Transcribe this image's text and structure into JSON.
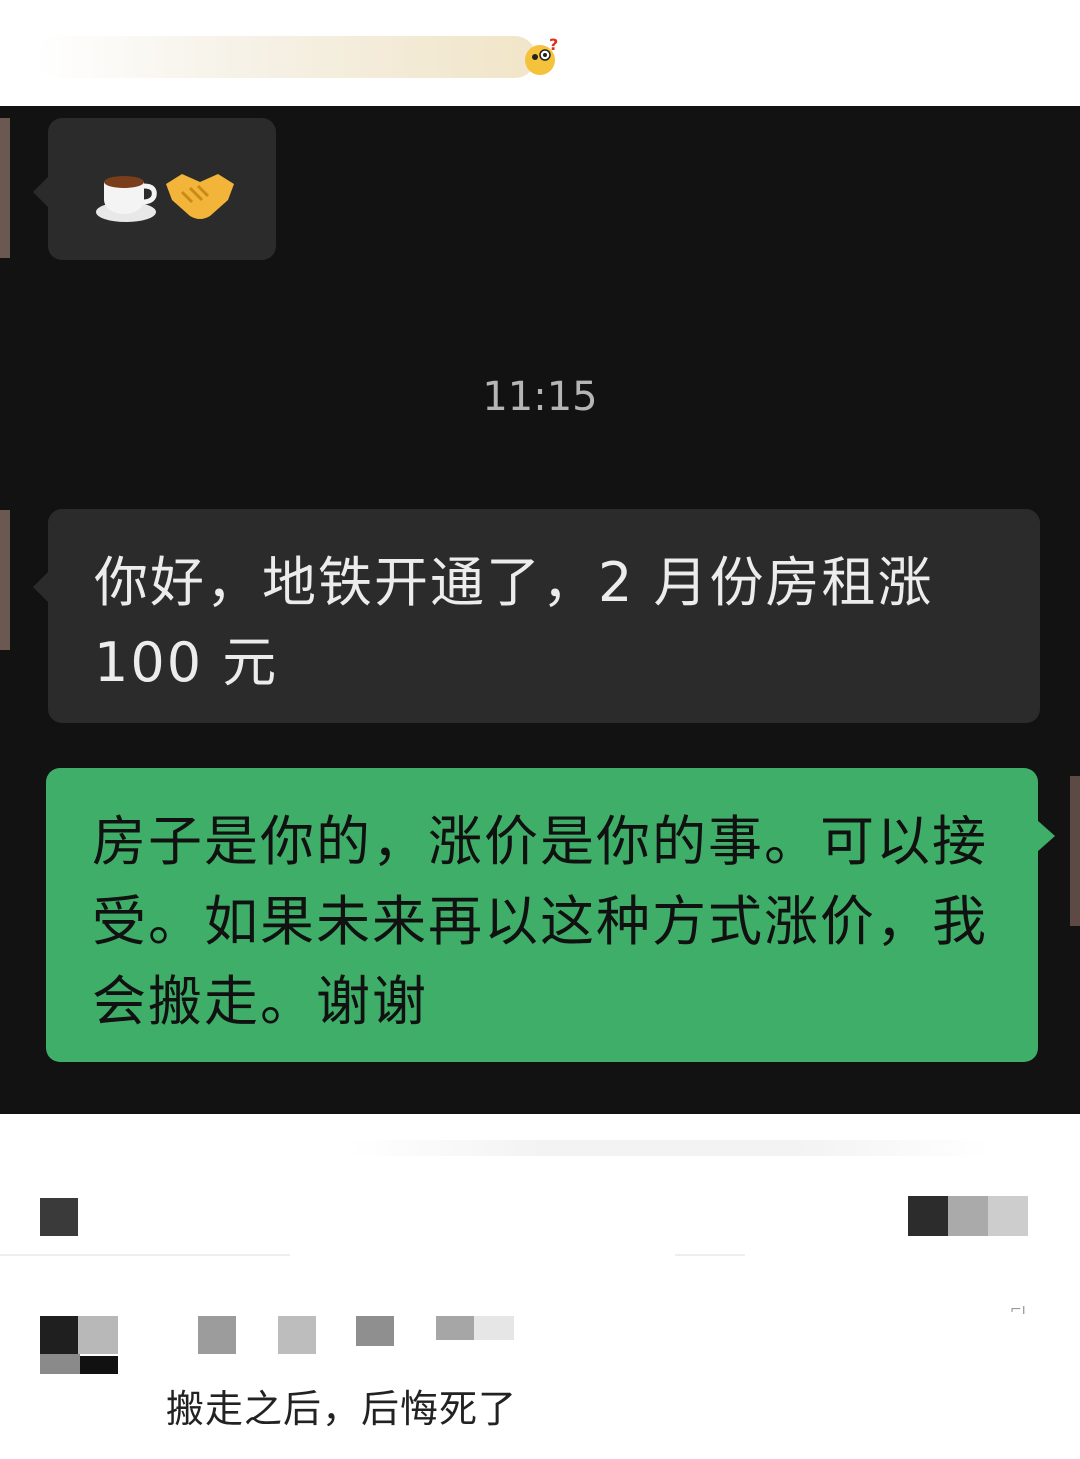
{
  "chat": {
    "emoji_message": "☕🤝",
    "timestamp": "11:15",
    "incoming_message": "你好，地铁开通了，2 月份房租涨 100 元",
    "outgoing_message": "房子是你的，涨价是你的事。可以接受。如果未来再以这种方式涨价，我会搬走。谢谢"
  },
  "comment": {
    "text": "搬走之后，后悔死了"
  },
  "colors": {
    "chat_background": "#121212",
    "incoming_bubble": "#2b2b2b",
    "outgoing_bubble": "#3fae68",
    "timestamp_text": "#b5b5b5"
  },
  "icons": {
    "top": "thinking-face-icon",
    "emoji_1": "coffee-cup-icon",
    "emoji_2": "handshake-icon"
  }
}
